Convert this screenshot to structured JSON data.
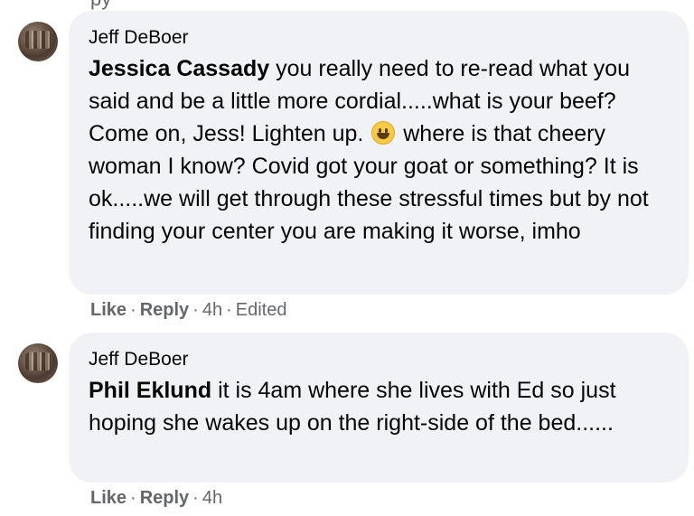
{
  "top_fragment": "py",
  "comments": [
    {
      "author": "Jeff DeBoer",
      "mention": "Jessica Cassady",
      "text_before_emoji": " you really need to re-read what you said and be a little more cordial.....what is your beef? Come on, Jess! Lighten up. ",
      "emoji": "grinning-face-icon",
      "text_after_emoji": " where is that cheery woman I know? Covid got your goat or something? It is ok.....we will get through these stressful times but by not finding your center you are making it worse, imho",
      "like_label": "Like",
      "reply_label": "Reply",
      "time": "4h",
      "edited_label": "Edited"
    },
    {
      "author": "Jeff DeBoer",
      "mention": "Phil Eklund",
      "text": " it is 4am where she lives with Ed so just hoping she wakes up on the right-side of the bed......",
      "like_label": "Like",
      "reply_label": "Reply",
      "time": "4h"
    }
  ],
  "colors": {
    "bubble_bg": "#f0f2f5",
    "meta_text": "#65676b",
    "text": "#050505"
  }
}
